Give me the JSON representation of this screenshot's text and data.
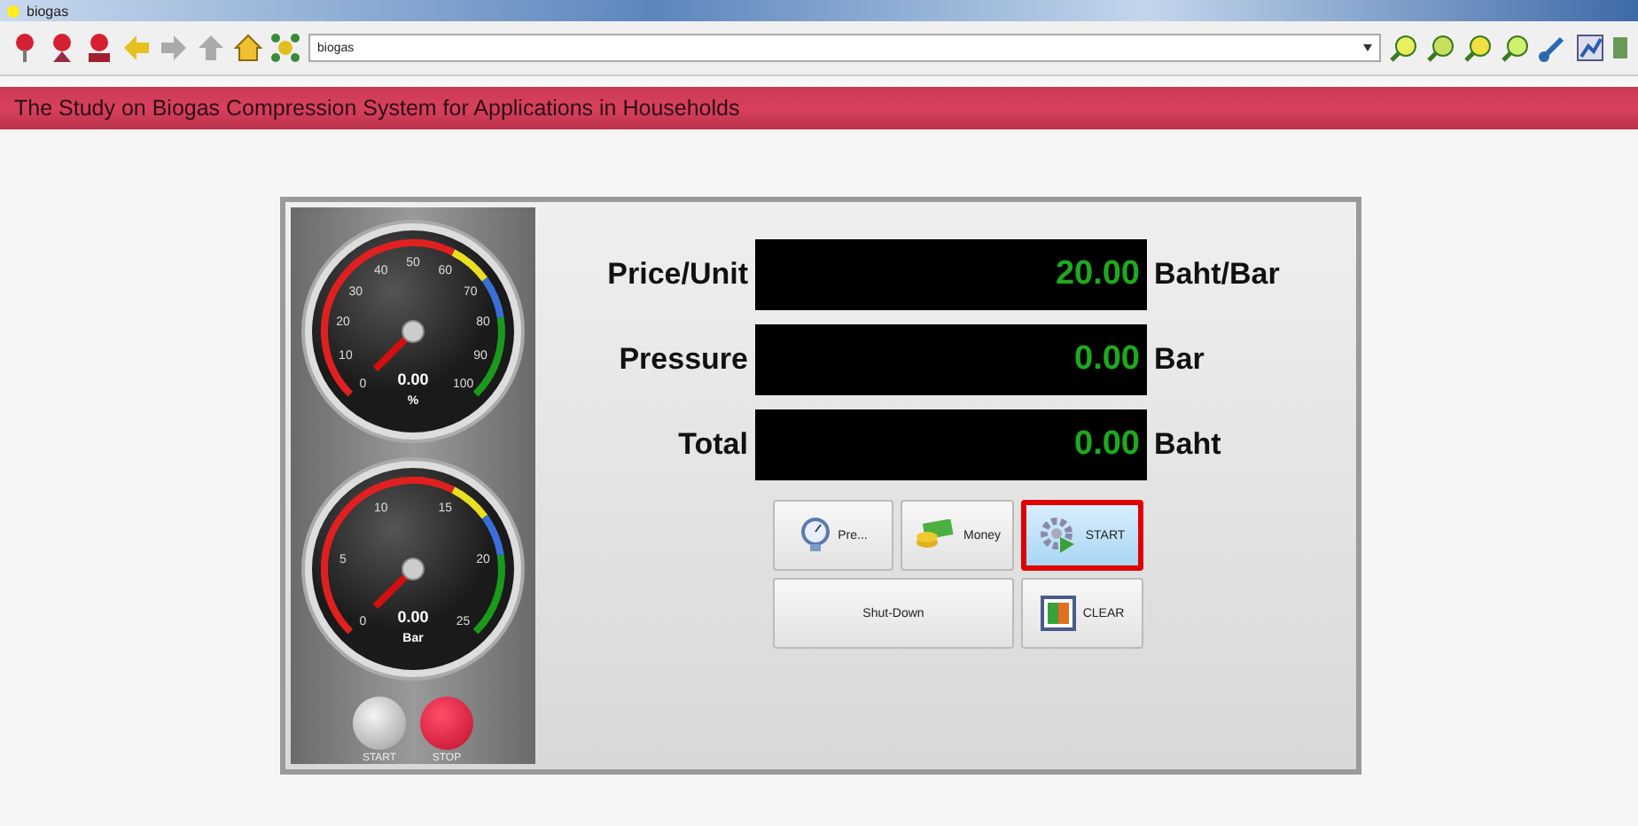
{
  "window": {
    "title": "biogas"
  },
  "toolbar": {
    "address": "biogas"
  },
  "banner": "The Study on Biogas Compression System for Applications in Households",
  "gauges": [
    {
      "ticks": [
        "0",
        "10",
        "20",
        "30",
        "40",
        "50",
        "60",
        "70",
        "80",
        "90",
        "100"
      ],
      "reading": "0.00",
      "unit": "%"
    },
    {
      "ticks": [
        "0",
        "5",
        "10",
        "15",
        "20",
        "25"
      ],
      "reading": "0.00",
      "unit": "Bar"
    }
  ],
  "lamps": [
    {
      "label": "START",
      "on": false
    },
    {
      "label": "STOP",
      "on": true
    }
  ],
  "readouts": [
    {
      "label": "Price/Unit",
      "value": "20.00",
      "unit": "Baht/Bar"
    },
    {
      "label": "Pressure",
      "value": "0.00",
      "unit": "Bar"
    },
    {
      "label": "Total",
      "value": "0.00",
      "unit": "Baht"
    }
  ],
  "buttons": [
    {
      "kind": "gauge",
      "label": "Pre...",
      "selected": false
    },
    {
      "kind": "money",
      "label": "Money",
      "selected": false
    },
    {
      "kind": "gear",
      "label": "START",
      "selected": true
    },
    {
      "kind": "plain",
      "label": "Shut-Down",
      "selected": false
    },
    {
      "kind": "clear",
      "label": "CLEAR",
      "selected": false
    }
  ]
}
